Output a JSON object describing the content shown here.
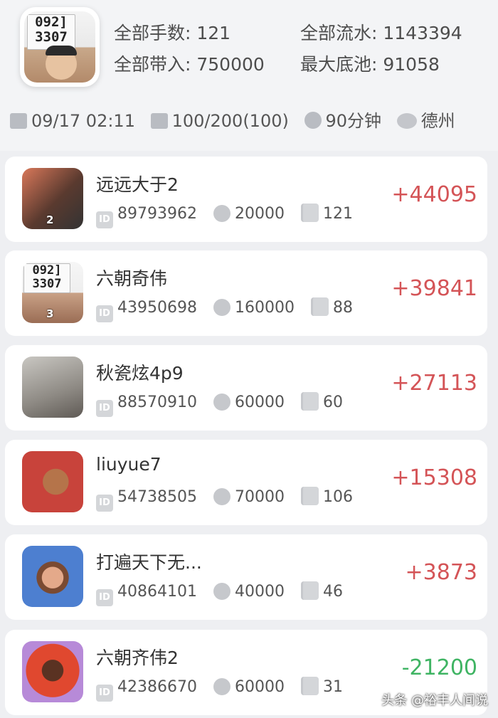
{
  "summary": {
    "total_hands": "全部手数: 121",
    "total_flow": "全部流水: 1143394",
    "total_buyin": "全部带入: 750000",
    "max_pot": "最大底池: 91058"
  },
  "host_avatar": {
    "sign_line1": "092]",
    "sign_line2": "3307"
  },
  "meta": {
    "datetime": "09/17 02:11",
    "blinds": "100/200(100)",
    "duration": "90分钟",
    "game_type": "德州"
  },
  "players": [
    {
      "name": "远远大于2",
      "id": "89793962",
      "buyin": "20000",
      "hands": "121",
      "score": "+44095",
      "rank": "2",
      "sign": "positive"
    },
    {
      "name": "六朝奇伟",
      "id": "43950698",
      "buyin": "160000",
      "hands": "88",
      "score": "+39841",
      "rank": "3",
      "sign": "positive",
      "sign_line1": "092]",
      "sign_line2": "3307"
    },
    {
      "name": "秋瓷炫4p9",
      "id": "88570910",
      "buyin": "60000",
      "hands": "60",
      "score": "+27113",
      "sign": "positive"
    },
    {
      "name": "liuyue7",
      "id": "54738505",
      "buyin": "70000",
      "hands": "106",
      "score": "+15308",
      "sign": "positive"
    },
    {
      "name": "打遍天下无...",
      "id": "40864101",
      "buyin": "40000",
      "hands": "46",
      "score": "+3873",
      "sign": "positive"
    },
    {
      "name": "六朝齐伟2",
      "id": "42386670",
      "buyin": "60000",
      "hands": "31",
      "score": "-21200",
      "sign": "negative"
    }
  ],
  "icons": {
    "id": "ID",
    "calendar": "calendar-icon",
    "coins": "coins-icon",
    "clock": "clock-icon",
    "game": "game-type-icon",
    "chip": "chip-icon",
    "hands": "hand-cards-icon"
  },
  "colors": {
    "positive": "#d45457",
    "negative": "#3fb463",
    "background": "#eeeff2"
  },
  "watermark": "头条 @裕丰人间说"
}
